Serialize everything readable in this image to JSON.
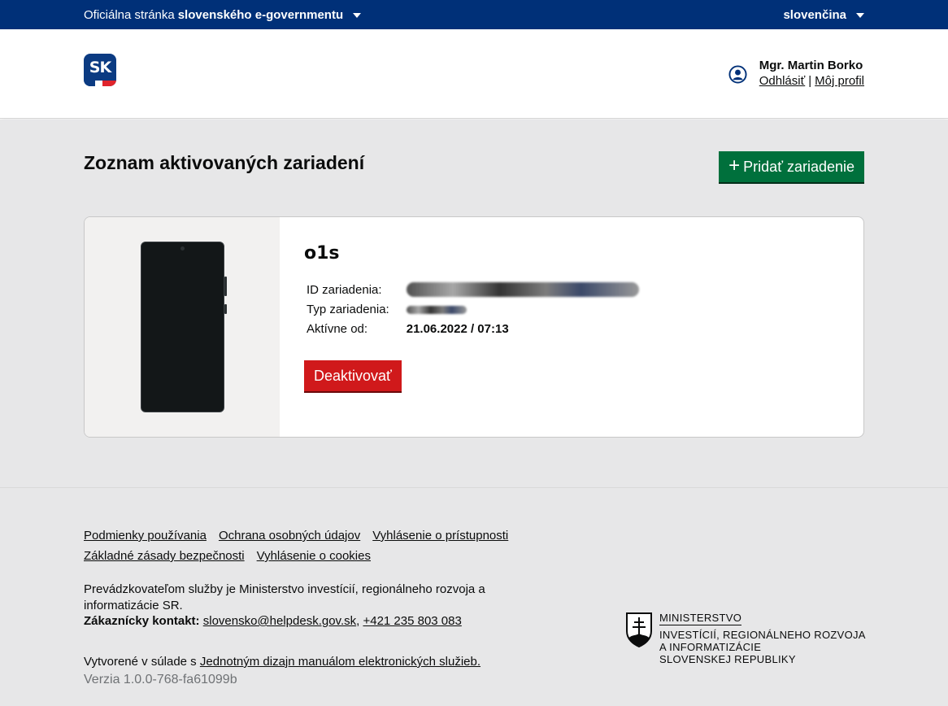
{
  "topbar": {
    "official_prefix": "Oficiálna stránka",
    "official_strong": "slovenského e-governmentu",
    "language": "slovenčina"
  },
  "header": {
    "logo_text": "SK",
    "user_name": "Mgr. Martin Borko",
    "logout_label": "Odhlásiť",
    "separator": "|",
    "profile_label": "Môj profil"
  },
  "main": {
    "title": "Zoznam aktivovaných zariadení",
    "add_button_icon": "+",
    "add_button_label": "Pridať zariadenie",
    "device": {
      "name": "o1s",
      "id_label": "ID zariadenia:",
      "type_label": "Typ zariadenia:",
      "active_label": "Aktívne od:",
      "active_value": "21.06.2022 / 07:13",
      "deactivate_label": "Deaktivovať"
    }
  },
  "footer": {
    "links_row1": [
      "Podmienky používania",
      "Ochrana osobných údajov",
      "Vyhlásenie o prístupnosti"
    ],
    "links_row2": [
      "Základné zásady bezpečnosti",
      "Vyhlásenie o cookies"
    ],
    "operator_text": "Prevádzkovateľom služby je Ministerstvo investícií, regionálneho rozvoja a informatizácie SR.",
    "contact_label": "Zákaznícky kontakt:",
    "contact_email": "slovensko@helpdesk.gov.sk",
    "contact_sep": ",",
    "contact_phone": "+421 235 803 083",
    "created_prefix": "Vytvorené v súlade s",
    "created_link": "Jednotným dizajn manuálom elektronických služieb.",
    "version": "Verzia 1.0.0-768-fa61099b",
    "ministry_line1": "MINISTERSTVO",
    "ministry_line2": "INVESTÍCIÍ, REGIONÁLNEHO ROZVOJA",
    "ministry_line3": "A INFORMATIZÁCIE",
    "ministry_line4": "SLOVENSKEJ REPUBLIKY"
  },
  "colors": {
    "topbar": "#003078",
    "primary_button": "#00703c",
    "danger_button": "#d0191b",
    "page_background": "#e7e7e8"
  }
}
